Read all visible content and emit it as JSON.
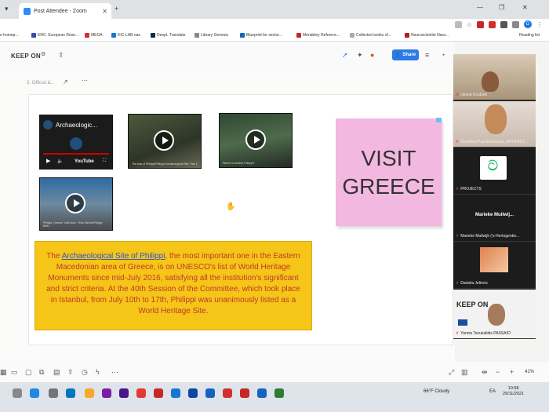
{
  "browser": {
    "tab_title": "Post Attendee - Zoom",
    "bookmarks": [
      "e homep...",
      "ERC: European Rese...",
      "MEGA",
      "KIC-LAB nas",
      "DeepL Translate",
      "Library Genesis",
      "Blueprint for sector...",
      "Mendeley Referenc...",
      "Collected works of...",
      "Neuroscientist Nara...",
      "Reading list"
    ],
    "profile_initial": "D"
  },
  "board": {
    "title": "KEEP ON",
    "share_label": "Share",
    "frame_label": "3. Official &..."
  },
  "videos": [
    {
      "title": "Archaeologic...",
      "brand": "YouTube"
    },
    {
      "title": "The loss of Philippi/Philippi Archaeological Site: Part 1"
    },
    {
      "title": "Where is Ancient Philippi?"
    },
    {
      "title": "Philippi, Greece: Visit town - Rick Steves/Philippi Both..."
    }
  ],
  "sticky": {
    "line1": "VISIT",
    "line2": "GREECE"
  },
  "textbox": {
    "before_link": "The ",
    "link_text": "Archaeological Site of Philippi",
    "after_link": ", the most important one in the Eastern Macedonian area of Greece, is on UNESCO's list of World Heritage Monuments since mid-July 2016, satisfying all the institution's significant and strict criteria. At the 40th Session of the Committee, which took place in Istanbul, from July 10th to 17th, Philippi was unanimously listed as a World Heritage Site."
  },
  "zoom_level": "41%",
  "participants": [
    {
      "name": "Liliana Krzdzek"
    },
    {
      "name": "Dorothea Papathanasiou_ARTIFACT..."
    },
    {
      "name": "PROJECTS"
    },
    {
      "name": "Marieke Muilwijk ('s-Hertogenbo...",
      "card_name": "Marieke Muilwij..."
    },
    {
      "name": "Daniela Jelincic"
    },
    {
      "name": "Yannis Tsoukalidis PASSAIO",
      "logo": "KEEP ON"
    }
  ],
  "taskbar": {
    "weather": "66°F Cloudy",
    "lang": "EA",
    "time": "10:58",
    "date": "29/11/2021"
  },
  "colors": {
    "share": "#2d7be5",
    "sticky": "#f3b8e0",
    "textbox_bg": "#f5c518",
    "textbox_text": "#c0392b",
    "link": "#2f56c9"
  }
}
